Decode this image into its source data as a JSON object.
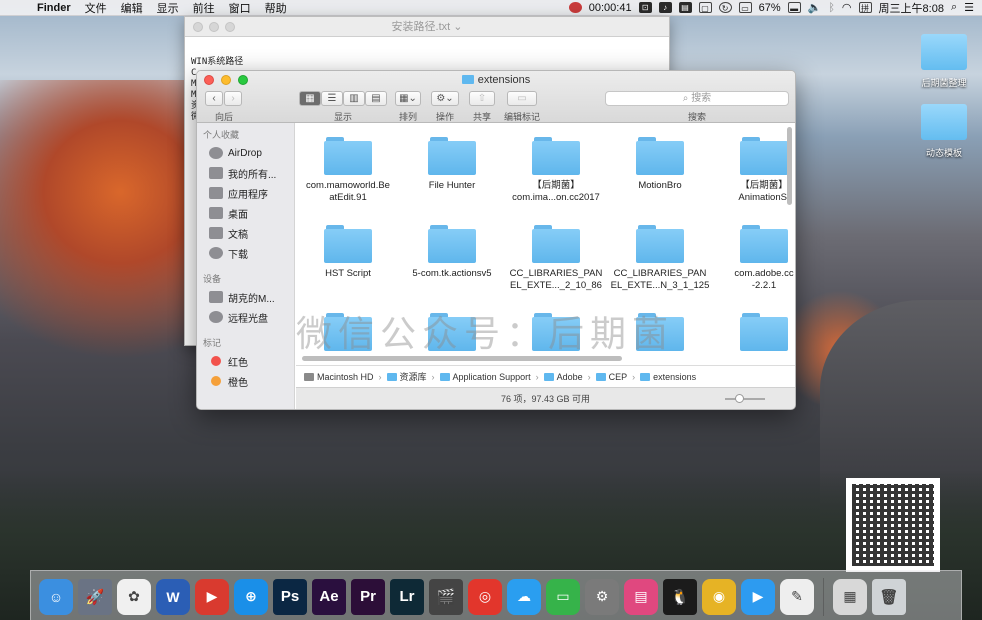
{
  "menubar": {
    "app_name": "Finder",
    "items": [
      "文件",
      "编辑",
      "显示",
      "前往",
      "窗口",
      "帮助"
    ],
    "time_elapsed": "00:00:41",
    "battery": "67%",
    "clock": "周三上午8:08"
  },
  "text_window": {
    "title": "安装路径.txt",
    "lines": [
      "WIN系统路径",
      "C:",
      "",
      "",
      "",
      "",
      "",
      "M",
      "M",
      "资",
      "",
      "",
      "",
      "微"
    ]
  },
  "finder": {
    "title": "extensions",
    "toolbar": {
      "back_label": "向后",
      "view_label": "显示",
      "arrange_label": "排列",
      "action_label": "操作",
      "share_label": "共享",
      "tags_label": "编辑标记",
      "search_label": "搜索",
      "search_placeholder": "搜索"
    },
    "sidebar": {
      "favorites_header": "个人收藏",
      "favorites": [
        {
          "label": "AirDrop",
          "icon": "airdrop-icon"
        },
        {
          "label": "我的所有...",
          "icon": "all-files-icon"
        },
        {
          "label": "应用程序",
          "icon": "applications-icon"
        },
        {
          "label": "桌面",
          "icon": "desktop-icon"
        },
        {
          "label": "文稿",
          "icon": "documents-icon"
        },
        {
          "label": "下载",
          "icon": "downloads-icon"
        }
      ],
      "devices_header": "设备",
      "devices": [
        {
          "label": "胡克的M...",
          "icon": "computer-icon"
        },
        {
          "label": "远程光盘",
          "icon": "disc-icon"
        }
      ],
      "tags_header": "标记",
      "tags": [
        {
          "label": "红色",
          "color": "#f2524c"
        },
        {
          "label": "橙色",
          "color": "#f5a03a"
        }
      ]
    },
    "items": [
      "com.mamoworld.Be\natEdit.91",
      "File Hunter",
      "【后期菌】\ncom.ima...on.cc2017",
      "MotionBro",
      "【后期菌】\nAnimationSt",
      "HST Script",
      "5-com.tk.actionsv5",
      "CC_LIBRARIES_PAN\nEL_EXTE..._2_10_86",
      "CC_LIBRARIES_PAN\nEL_EXTE...N_3_1_125",
      "com.adobe.cc\n-2.2.1"
    ],
    "path": [
      "Macintosh HD",
      "资源库",
      "Application Support",
      "Adobe",
      "CEP",
      "extensions"
    ],
    "status": "76 项，97.43 GB 可用"
  },
  "watermark": "微信公众号：后期菌",
  "desktop": {
    "icons": [
      "后期菌整理",
      "动态模板"
    ]
  },
  "dock": {
    "apps": [
      {
        "name": "finder-icon",
        "color": "#3b8fe0",
        "glyph": "☺"
      },
      {
        "name": "launchpad-icon",
        "color": "#6a7384",
        "glyph": "🚀"
      },
      {
        "name": "photos-icon",
        "color": "#f0f0f0",
        "glyph": "✿"
      },
      {
        "name": "word-icon",
        "color": "#2b5eb5",
        "glyph": "W"
      },
      {
        "name": "video-player-icon",
        "color": "#d93a2f",
        "glyph": "▶"
      },
      {
        "name": "safari-icon",
        "color": "#1a8fe8",
        "glyph": "⊕"
      },
      {
        "name": "photoshop-icon",
        "color": "#0b2743",
        "glyph": "Ps"
      },
      {
        "name": "after-effects-icon",
        "color": "#2a0f3e",
        "glyph": "Ae"
      },
      {
        "name": "premiere-icon",
        "color": "#2c0e38",
        "glyph": "Pr"
      },
      {
        "name": "lightroom-icon",
        "color": "#0e2936",
        "glyph": "Lr"
      },
      {
        "name": "final-cut-icon",
        "color": "#444",
        "glyph": "🎬"
      },
      {
        "name": "netease-music-icon",
        "color": "#e2362c",
        "glyph": "◎"
      },
      {
        "name": "cloud-icon",
        "color": "#2a9ef0",
        "glyph": "☁"
      },
      {
        "name": "screen-record-icon",
        "color": "#36b34a",
        "glyph": "▭"
      },
      {
        "name": "system-preferences-icon",
        "color": "#7a7a7a",
        "glyph": "⚙"
      },
      {
        "name": "clean-my-mac-icon",
        "color": "#e0487f",
        "glyph": "▤"
      },
      {
        "name": "qq-icon",
        "color": "#1b1b1b",
        "glyph": "🐧"
      },
      {
        "name": "chrome-icon",
        "color": "#e6b325",
        "glyph": "◉"
      },
      {
        "name": "facetime-icon",
        "color": "#2d9bf0",
        "glyph": "▶"
      },
      {
        "name": "notes-icon",
        "color": "#eeeeee",
        "glyph": "✎"
      }
    ],
    "right_apps": [
      {
        "name": "preview-icon",
        "color": "#d8d8d8",
        "glyph": "▦"
      },
      {
        "name": "trash-icon",
        "color": "#cfd3d6",
        "glyph": "🗑"
      }
    ]
  }
}
